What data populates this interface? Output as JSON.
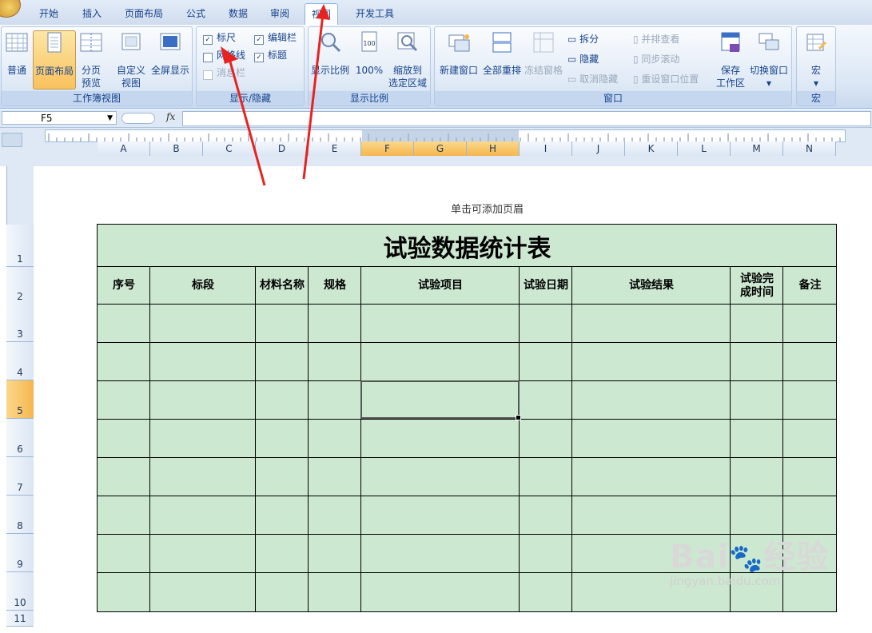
{
  "tabs": [
    "开始",
    "插入",
    "页面布局",
    "公式",
    "数据",
    "审阅",
    "视图",
    "开发工具"
  ],
  "active_tab": "视图",
  "ribbon": {
    "workbook_views": {
      "label": "工作簿视图",
      "normal": "普通",
      "page_layout": "页面布局",
      "page_break_l1": "分页",
      "page_break_l2": "预览",
      "custom_l1": "自定义",
      "custom_l2": "视图",
      "fullscreen": "全屏显示"
    },
    "show_hide": {
      "label": "显示/隐藏",
      "ruler": "标尺",
      "gridlines": "网格线",
      "message_bar": "消息栏",
      "formula_bar": "编辑栏",
      "headings": "标题"
    },
    "zoom": {
      "label": "显示比例",
      "zoom": "显示比例",
      "hundred": "100%",
      "to_sel_l1": "缩放到",
      "to_sel_l2": "选定区域"
    },
    "window": {
      "label": "窗口",
      "new_window": "新建窗口",
      "arrange_all": "全部重排",
      "freeze": "冻结窗格",
      "split": "拆分",
      "hide": "隐藏",
      "unhide": "取消隐藏",
      "side_by_side": "并排查看",
      "sync_scroll": "同步滚动",
      "reset_pos": "重设窗口位置",
      "save_ws_l1": "保存",
      "save_ws_l2": "工作区",
      "switch": "切换窗口"
    },
    "macros": {
      "label": "宏",
      "macros": "宏"
    }
  },
  "formula_bar": {
    "name_box": "F5",
    "fx": "fx"
  },
  "columns": [
    "A",
    "B",
    "C",
    "D",
    "E",
    "F",
    "G",
    "H",
    "I",
    "J",
    "K",
    "L",
    "M",
    "N"
  ],
  "selected_columns": [
    "F",
    "G",
    "H"
  ],
  "rows": [
    "1",
    "2",
    "3",
    "4",
    "5",
    "6",
    "7",
    "8",
    "9",
    "10",
    "11"
  ],
  "selected_row": "5",
  "header_hint": "单击可添加页眉",
  "sheet": {
    "title": "试验数据统计表",
    "headers": [
      "序号",
      "标段",
      "材料名称",
      "规格",
      "试验项目",
      "试验日期",
      "试验结果",
      "试验完\n成时间",
      "备注"
    ]
  },
  "watermark": {
    "brand": "Bai",
    "brand2": "经验",
    "url": "jingyan.baidu.com"
  },
  "colors": {
    "accent": "#cde8d1",
    "arrow": "#e8231f",
    "ribbon_blue": "#15428b"
  }
}
